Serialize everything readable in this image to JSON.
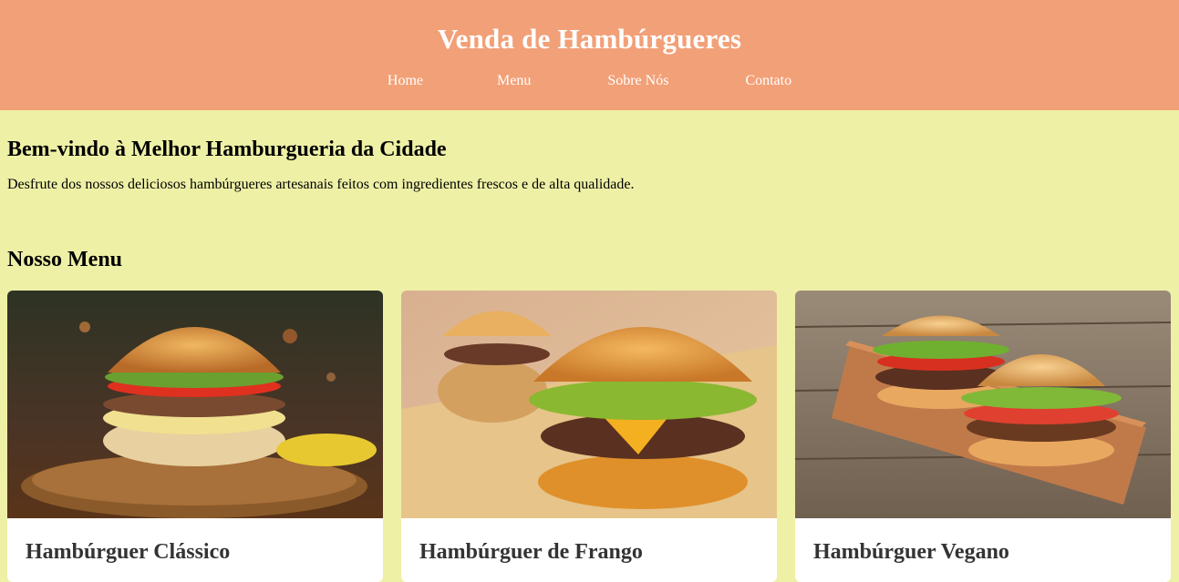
{
  "header": {
    "title": "Venda de Hambúrgueres",
    "nav": [
      "Home",
      "Menu",
      "Sobre Nós",
      "Contato"
    ]
  },
  "welcome": {
    "heading": "Bem-vindo à Melhor Hamburgueria da Cidade",
    "text": "Desfrute dos nossos deliciosos hambúrgueres artesanais feitos com ingredientes frescos e de alta qualidade."
  },
  "menu": {
    "heading": "Nosso Menu",
    "items": [
      {
        "name": "Hambúrguer Clássico",
        "image": "classic-burger-photo"
      },
      {
        "name": "Hambúrguer de Frango",
        "image": "chicken-burger-photo"
      },
      {
        "name": "Hambúrguer Vegano",
        "image": "vegan-burger-photo"
      }
    ]
  },
  "colors": {
    "header_bg": "#f2a077",
    "page_bg": "#eef0a6",
    "card_bg": "#ffffff"
  }
}
